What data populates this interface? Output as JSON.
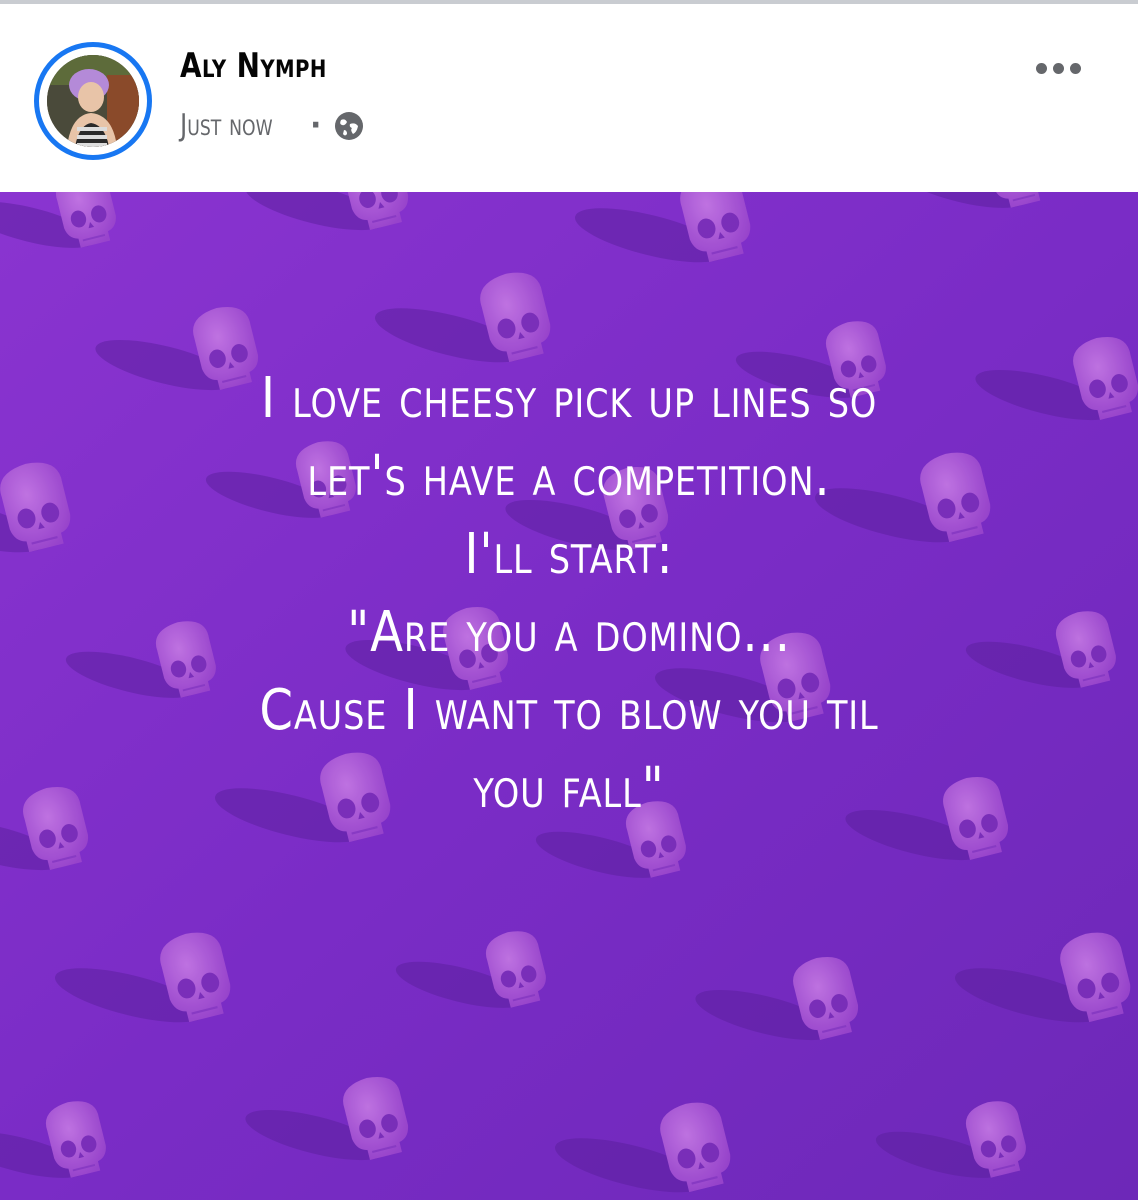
{
  "post": {
    "author": "Aly Nymph",
    "timestamp": "Just now",
    "separator": "·",
    "audience_icon": "globe-icon",
    "more_icon": "more-options-icon",
    "lines": [
      "I love cheesy pick up lines so",
      "let's have a competition.",
      "I'll start:",
      "\"Are you a domino...",
      "Cause I want to blow you til",
      "you fall\""
    ]
  },
  "colors": {
    "accent": "#1877f2",
    "background_purple": "#7b2fc4",
    "skull": "#b05ad6",
    "text": "#ffffff"
  }
}
